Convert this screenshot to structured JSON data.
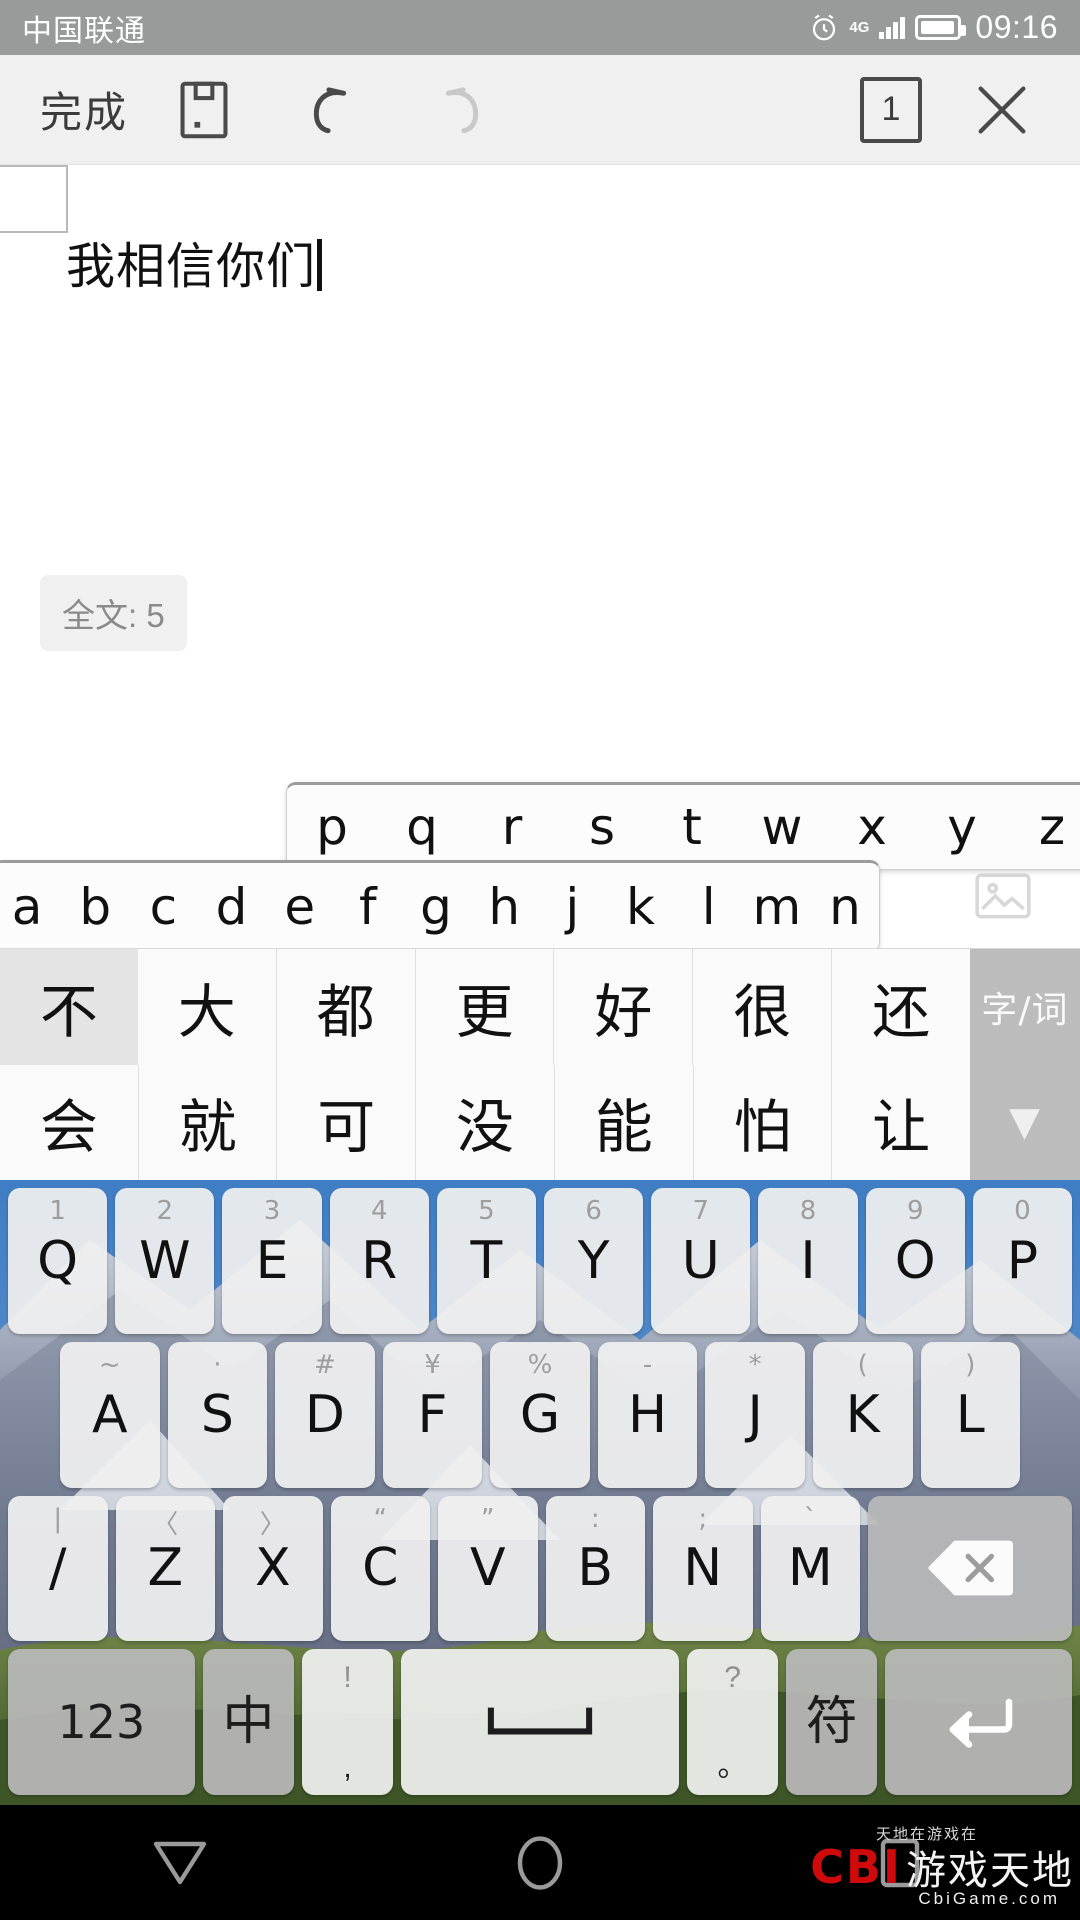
{
  "status_bar": {
    "carrier": "中国联通",
    "network": "4G",
    "time": "09:16",
    "icons": [
      "alarm-icon",
      "network-4g-icon",
      "signal-icon",
      "battery-icon"
    ]
  },
  "toolbar": {
    "done_label": "完成",
    "page_count": "1",
    "icons": [
      "save-icon",
      "undo-icon",
      "redo-icon",
      "page-count-badge",
      "close-icon"
    ]
  },
  "document": {
    "text": "我相信你们",
    "word_count_label": "全文: 5"
  },
  "app_iconbar": {
    "icons": [
      "shapes-icon",
      "keyboard-icon",
      "emoji-icon",
      "card-icon",
      "font-size-icon",
      "paragraph-icon",
      "image-icon"
    ]
  },
  "letter_popups": {
    "top_row": [
      "p",
      "q",
      "r",
      "s",
      "t",
      "w",
      "x",
      "y",
      "z"
    ],
    "bottom_row": [
      "a",
      "b",
      "c",
      "d",
      "e",
      "f",
      "g",
      "h",
      "j",
      "k",
      "l",
      "m",
      "n"
    ]
  },
  "candidates": {
    "row1": [
      "不",
      "大",
      "都",
      "更",
      "好",
      "很",
      "还"
    ],
    "row2": [
      "会",
      "就",
      "可",
      "没",
      "能",
      "怕",
      "让"
    ],
    "selected_index": 0,
    "mode_button": "字/词",
    "expand_button": "▼"
  },
  "keyboard": {
    "row1": [
      {
        "main": "Q",
        "hint": "1"
      },
      {
        "main": "W",
        "hint": "2"
      },
      {
        "main": "E",
        "hint": "3"
      },
      {
        "main": "R",
        "hint": "4"
      },
      {
        "main": "T",
        "hint": "5"
      },
      {
        "main": "Y",
        "hint": "6"
      },
      {
        "main": "U",
        "hint": "7"
      },
      {
        "main": "I",
        "hint": "8"
      },
      {
        "main": "O",
        "hint": "9"
      },
      {
        "main": "P",
        "hint": "0"
      }
    ],
    "row2": [
      {
        "main": "A",
        "hint": "~"
      },
      {
        "main": "S",
        "hint": "·"
      },
      {
        "main": "D",
        "hint": "#"
      },
      {
        "main": "F",
        "hint": "¥"
      },
      {
        "main": "G",
        "hint": "%"
      },
      {
        "main": "H",
        "hint": "-"
      },
      {
        "main": "J",
        "hint": "*"
      },
      {
        "main": "K",
        "hint": "("
      },
      {
        "main": "L",
        "hint": ")"
      }
    ],
    "row3": [
      {
        "main": "/",
        "hint": "|"
      },
      {
        "main": "Z",
        "hint": "〈"
      },
      {
        "main": "X",
        "hint": "〉"
      },
      {
        "main": "C",
        "hint": "“"
      },
      {
        "main": "V",
        "hint": "”"
      },
      {
        "main": "B",
        "hint": ":"
      },
      {
        "main": "N",
        "hint": ";"
      },
      {
        "main": "M",
        "hint": "`"
      }
    ],
    "backspace": "backspace-icon",
    "row4": {
      "numbers": "123",
      "lang": "中",
      "comma_top": "!",
      "comma_bottom": ",",
      "space": "space-icon",
      "period_top": "?",
      "period_bottom": "。",
      "symbols": "符",
      "enter": "enter-icon"
    }
  },
  "navbar": {
    "buttons": [
      "back-icon",
      "home-icon",
      "recents-icon"
    ],
    "watermark": {
      "brand": "CBI",
      "name": "游戏天地",
      "url": "CbiGame.com",
      "tagline": "天地在游戏在"
    }
  },
  "colors": {
    "status_bar_bg": "#999a9a",
    "toolbar_bg": "#f0f0f0",
    "candidate_bg": "#fafafa",
    "selected_candidate": "#e4e4e4",
    "fn_key": "#bababa",
    "watermark_red": "#cf0a0a"
  }
}
